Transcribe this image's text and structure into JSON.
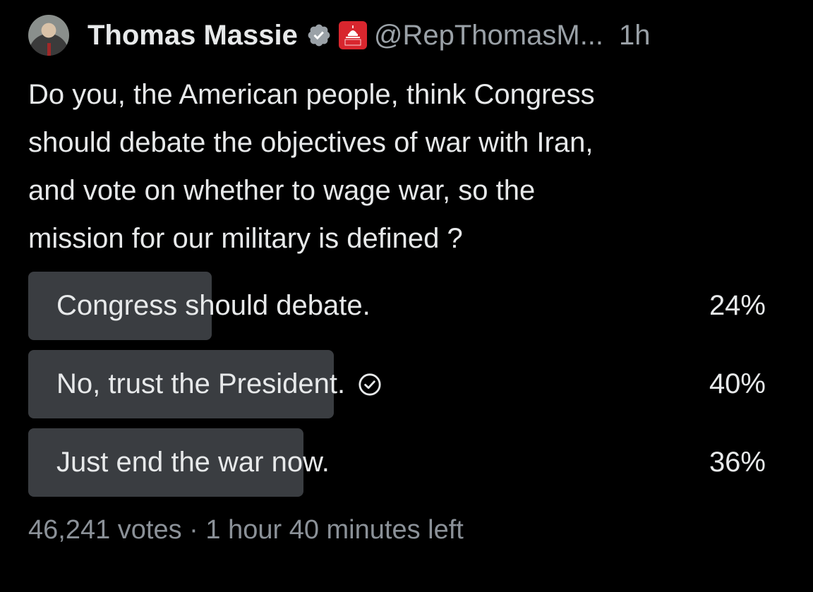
{
  "author": {
    "display_name": "Thomas Massie",
    "handle": "@RepThomasM...",
    "time_ago": "1h",
    "verified_icon": "verified-badge-icon",
    "affiliation_icon": "house-gop-icon",
    "affiliation_badge_text": "HOUSE GOP"
  },
  "tweet": {
    "text": "Do you, the American people, think Congress\nshould debate the objectives of war with Iran,\nand vote on whether to wage war, so the\nmission for our military is defined ?"
  },
  "poll": {
    "options": [
      {
        "label": "Congress should debate.",
        "percent": "24%",
        "value": 24,
        "selected": false
      },
      {
        "label": "No, trust the President.",
        "percent": "40%",
        "value": 40,
        "selected": true
      },
      {
        "label": "Just end the war now.",
        "percent": "36%",
        "value": 36,
        "selected": false
      }
    ],
    "votes": "46,241 votes",
    "separator": "·",
    "time_left": "1 hour 40 minutes left"
  },
  "colors": {
    "background": "#000000",
    "text": "#e7e9ea",
    "muted": "#9aa1a7",
    "poll_fill": "#3a3d41",
    "gop_red": "#d8262e"
  }
}
